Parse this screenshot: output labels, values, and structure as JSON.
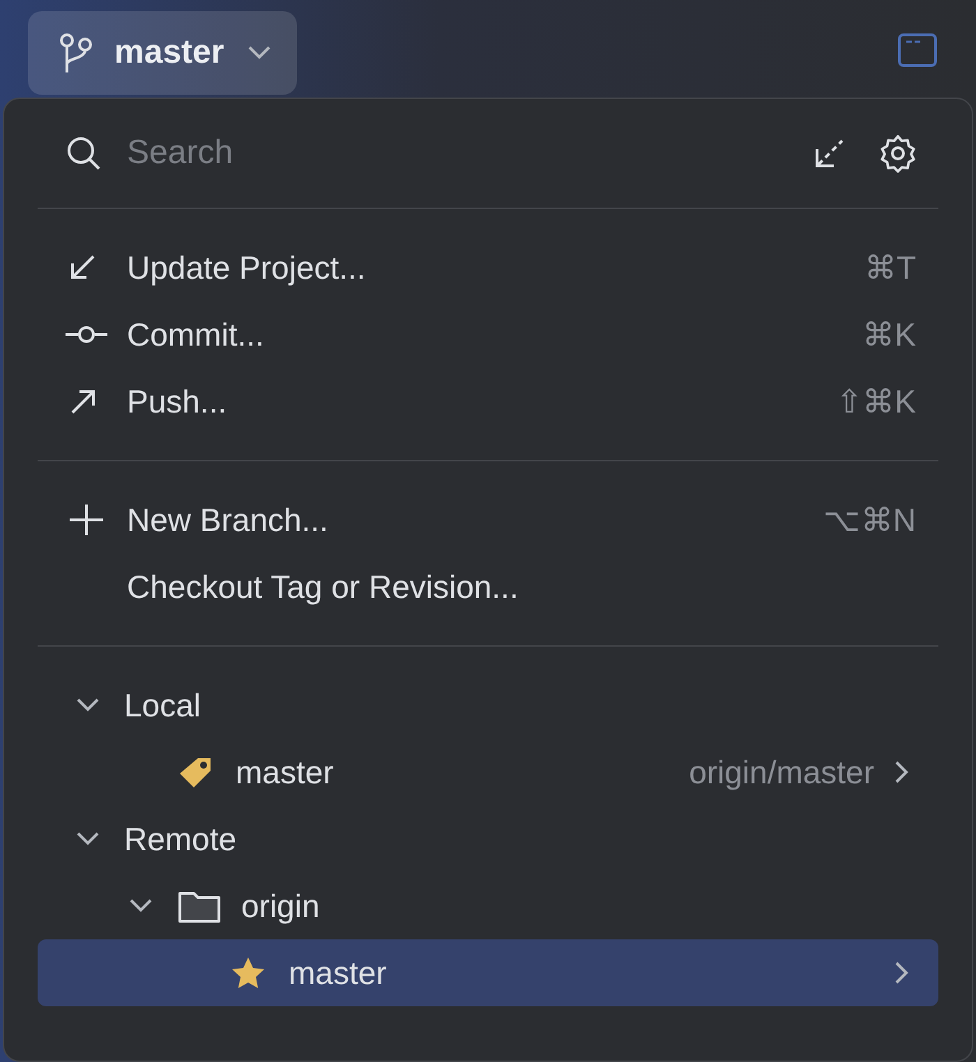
{
  "toolbar": {
    "branch_button": {
      "label": "master"
    }
  },
  "popup": {
    "search": {
      "placeholder": "Search"
    },
    "action_groups": [
      [
        {
          "kind": "update",
          "label": "Update Project...",
          "shortcut": "⌘T"
        },
        {
          "kind": "commit",
          "label": "Commit...",
          "shortcut": "⌘K"
        },
        {
          "kind": "push",
          "label": "Push...",
          "shortcut": "⇧⌘K"
        }
      ],
      [
        {
          "kind": "new_branch",
          "label": "New Branch...",
          "shortcut": "⌥⌘N"
        },
        {
          "kind": "checkout",
          "label": "Checkout Tag or Revision..."
        }
      ]
    ],
    "tree": [
      {
        "kind": "group",
        "label": "Local",
        "expanded": true,
        "children": [
          {
            "kind": "current_branch",
            "label": "master",
            "tracking": "origin/master",
            "selected": false
          }
        ]
      },
      {
        "kind": "group",
        "label": "Remote",
        "expanded": true,
        "children": [
          {
            "kind": "folder",
            "label": "origin",
            "expanded": true,
            "children": [
              {
                "kind": "favorite_branch",
                "label": "master",
                "selected": true
              }
            ]
          }
        ]
      }
    ]
  }
}
